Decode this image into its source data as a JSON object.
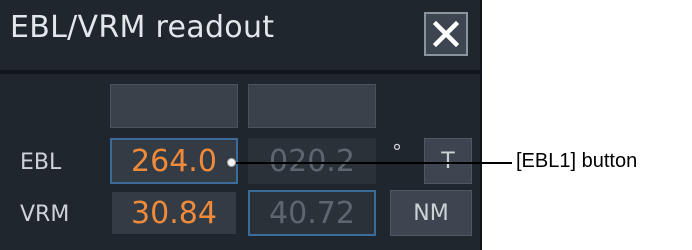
{
  "window": {
    "title": "EBL/VRM readout",
    "close_icon": "close-icon"
  },
  "ebl_row": {
    "label": "EBL",
    "ebl1_value": "264.0",
    "ebl2_value": "020.2",
    "unit": "°",
    "mode_button_label": "T"
  },
  "vrm_row": {
    "label": "VRM",
    "vrm1_value": "30.84",
    "vrm2_value": "40.72",
    "unit_button_label": "NM"
  },
  "callout": {
    "text": "[EBL1] button"
  },
  "colors": {
    "panel_bg": "#1f262e",
    "active_value": "#ef8a3b",
    "inactive_value": "#5d666f",
    "selected_border": "#3c6b9a"
  }
}
